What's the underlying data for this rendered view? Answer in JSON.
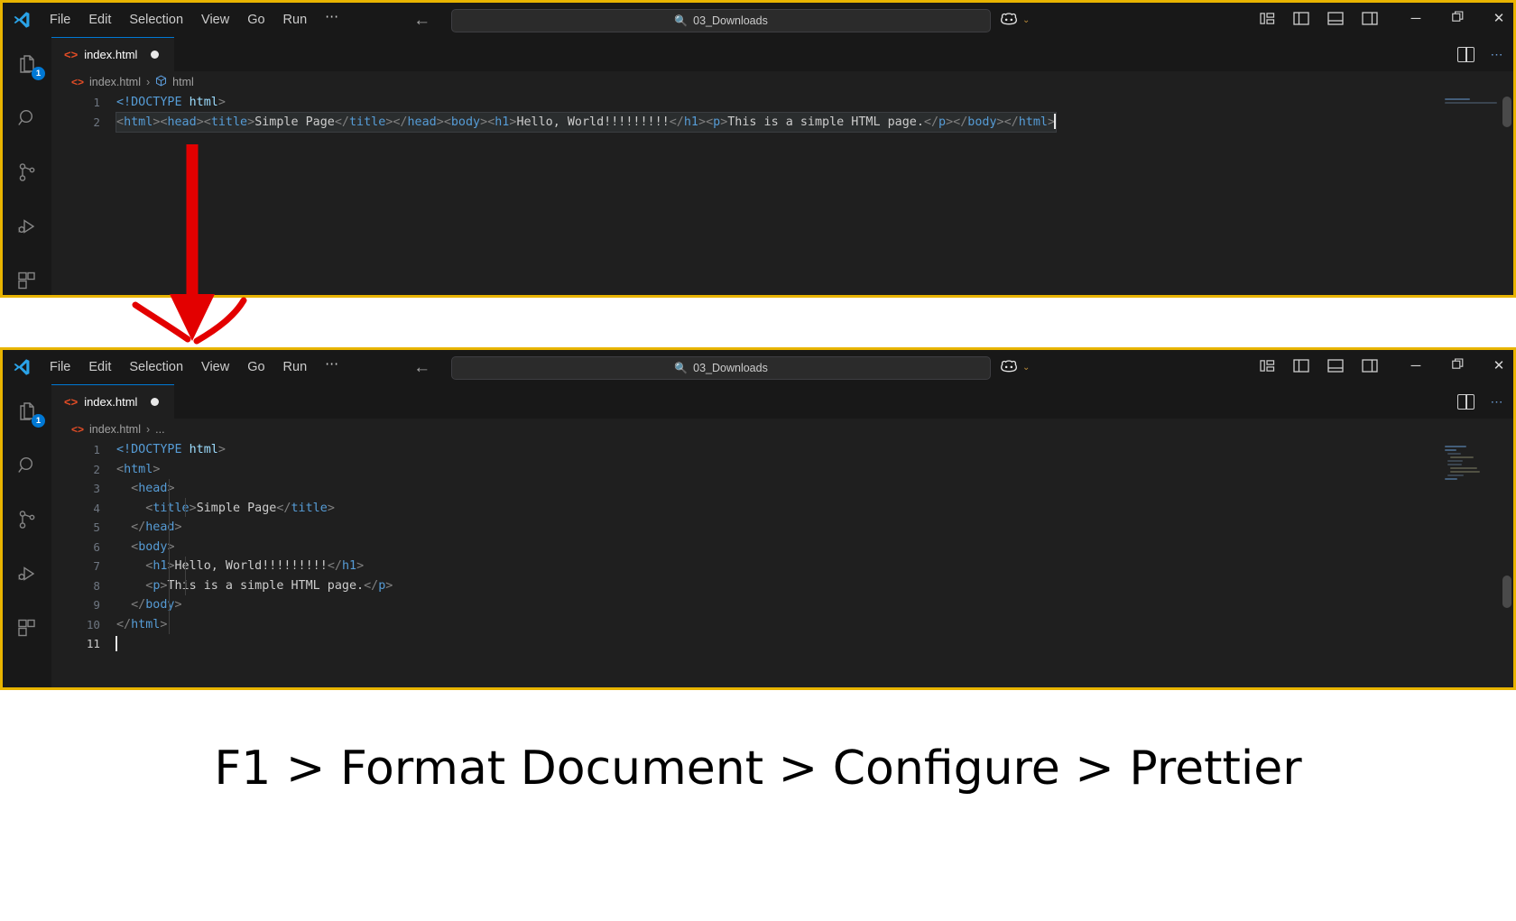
{
  "window": {
    "menu_items": [
      "File",
      "Edit",
      "Selection",
      "View",
      "Go",
      "Run",
      "⋯"
    ],
    "command_center_text": "03_Downloads",
    "search_icon": "search-icon",
    "copilot_icon": "copilot-icon",
    "chevron": "⌄",
    "nav_back": "←",
    "nav_forward": "→",
    "minimize": "─",
    "restore": "❐",
    "close": "✕"
  },
  "activitybar": {
    "items": [
      {
        "name": "explorer-icon",
        "badge": "1"
      },
      {
        "name": "search-icon",
        "badge": ""
      },
      {
        "name": "source-control-icon",
        "badge": ""
      },
      {
        "name": "run-and-debug-icon",
        "badge": ""
      },
      {
        "name": "extensions-icon",
        "badge": ""
      }
    ]
  },
  "editor_top": {
    "tab_label": "index.html",
    "tab_dirty": true,
    "breadcrumb": [
      "index.html",
      "html"
    ],
    "breadcrumb_separator": "›",
    "lines": [
      {
        "num": "1",
        "segments": [
          {
            "t": "<!DOCTYPE",
            "c": "tok-doctype"
          },
          {
            "t": " ",
            "c": "tok-text"
          },
          {
            "t": "html",
            "c": "tok-attrname"
          },
          {
            "t": ">",
            "c": "tok-bracket"
          }
        ]
      },
      {
        "num": "2",
        "selected": true,
        "segments": [
          {
            "t": "<",
            "c": "tok-bracket"
          },
          {
            "t": "html",
            "c": "tok-tag"
          },
          {
            "t": ">",
            "c": "tok-bracket"
          },
          {
            "t": "<",
            "c": "tok-bracket"
          },
          {
            "t": "head",
            "c": "tok-tag"
          },
          {
            "t": ">",
            "c": "tok-bracket"
          },
          {
            "t": "<",
            "c": "tok-bracket"
          },
          {
            "t": "title",
            "c": "tok-tag"
          },
          {
            "t": ">",
            "c": "tok-bracket"
          },
          {
            "t": "Simple Page",
            "c": "tok-text"
          },
          {
            "t": "</",
            "c": "tok-bracket"
          },
          {
            "t": "title",
            "c": "tok-tag"
          },
          {
            "t": ">",
            "c": "tok-bracket"
          },
          {
            "t": "</",
            "c": "tok-bracket"
          },
          {
            "t": "head",
            "c": "tok-tag"
          },
          {
            "t": ">",
            "c": "tok-bracket"
          },
          {
            "t": "<",
            "c": "tok-bracket"
          },
          {
            "t": "body",
            "c": "tok-tag"
          },
          {
            "t": ">",
            "c": "tok-bracket"
          },
          {
            "t": "<",
            "c": "tok-bracket"
          },
          {
            "t": "h1",
            "c": "tok-tag"
          },
          {
            "t": ">",
            "c": "tok-bracket"
          },
          {
            "t": "Hello, World!!!!!!!!!",
            "c": "tok-text"
          },
          {
            "t": "</",
            "c": "tok-bracket"
          },
          {
            "t": "h1",
            "c": "tok-tag"
          },
          {
            "t": ">",
            "c": "tok-bracket"
          },
          {
            "t": "<",
            "c": "tok-bracket"
          },
          {
            "t": "p",
            "c": "tok-tag"
          },
          {
            "t": ">",
            "c": "tok-bracket"
          },
          {
            "t": "This is a simple HTML page.",
            "c": "tok-text"
          },
          {
            "t": "</",
            "c": "tok-bracket"
          },
          {
            "t": "p",
            "c": "tok-tag"
          },
          {
            "t": ">",
            "c": "tok-bracket"
          },
          {
            "t": "</",
            "c": "tok-bracket"
          },
          {
            "t": "body",
            "c": "tok-tag"
          },
          {
            "t": ">",
            "c": "tok-bracket"
          },
          {
            "t": "</",
            "c": "tok-bracket"
          },
          {
            "t": "html",
            "c": "tok-tag"
          },
          {
            "t": ">",
            "c": "tok-bracket"
          }
        ]
      }
    ]
  },
  "editor_bottom": {
    "tab_label": "index.html",
    "tab_dirty": true,
    "breadcrumb": [
      "index.html",
      "..."
    ],
    "breadcrumb_separator": "›",
    "lines": [
      {
        "num": "1",
        "segments": [
          {
            "t": "<!DOCTYPE",
            "c": "tok-doctype"
          },
          {
            "t": " ",
            "c": "tok-text"
          },
          {
            "t": "html",
            "c": "tok-attrname"
          },
          {
            "t": ">",
            "c": "tok-bracket"
          }
        ]
      },
      {
        "num": "2",
        "segments": [
          {
            "t": "<",
            "c": "tok-bracket"
          },
          {
            "t": "html",
            "c": "tok-tag"
          },
          {
            "t": ">",
            "c": "tok-bracket"
          }
        ]
      },
      {
        "num": "3",
        "segments": [
          {
            "t": "  <",
            "c": "tok-bracket"
          },
          {
            "t": "head",
            "c": "tok-tag"
          },
          {
            "t": ">",
            "c": "tok-bracket"
          }
        ]
      },
      {
        "num": "4",
        "segments": [
          {
            "t": "    <",
            "c": "tok-bracket"
          },
          {
            "t": "title",
            "c": "tok-tag"
          },
          {
            "t": ">",
            "c": "tok-bracket"
          },
          {
            "t": "Simple Page",
            "c": "tok-text"
          },
          {
            "t": "</",
            "c": "tok-bracket"
          },
          {
            "t": "title",
            "c": "tok-tag"
          },
          {
            "t": ">",
            "c": "tok-bracket"
          }
        ]
      },
      {
        "num": "5",
        "segments": [
          {
            "t": "  </",
            "c": "tok-bracket"
          },
          {
            "t": "head",
            "c": "tok-tag"
          },
          {
            "t": ">",
            "c": "tok-bracket"
          }
        ]
      },
      {
        "num": "6",
        "segments": [
          {
            "t": "  <",
            "c": "tok-bracket"
          },
          {
            "t": "body",
            "c": "tok-tag"
          },
          {
            "t": ">",
            "c": "tok-bracket"
          }
        ]
      },
      {
        "num": "7",
        "segments": [
          {
            "t": "    <",
            "c": "tok-bracket"
          },
          {
            "t": "h1",
            "c": "tok-tag"
          },
          {
            "t": ">",
            "c": "tok-bracket"
          },
          {
            "t": "Hello, World!!!!!!!!!",
            "c": "tok-text"
          },
          {
            "t": "</",
            "c": "tok-bracket"
          },
          {
            "t": "h1",
            "c": "tok-tag"
          },
          {
            "t": ">",
            "c": "tok-bracket"
          }
        ]
      },
      {
        "num": "8",
        "segments": [
          {
            "t": "    <",
            "c": "tok-bracket"
          },
          {
            "t": "p",
            "c": "tok-tag"
          },
          {
            "t": ">",
            "c": "tok-bracket"
          },
          {
            "t": "This is a simple HTML page.",
            "c": "tok-text"
          },
          {
            "t": "</",
            "c": "tok-bracket"
          },
          {
            "t": "p",
            "c": "tok-tag"
          },
          {
            "t": ">",
            "c": "tok-bracket"
          }
        ]
      },
      {
        "num": "9",
        "segments": [
          {
            "t": "  </",
            "c": "tok-bracket"
          },
          {
            "t": "body",
            "c": "tok-tag"
          },
          {
            "t": ">",
            "c": "tok-bracket"
          }
        ]
      },
      {
        "num": "10",
        "segments": [
          {
            "t": "</",
            "c": "tok-bracket"
          },
          {
            "t": "html",
            "c": "tok-tag"
          },
          {
            "t": ">",
            "c": "tok-bracket"
          }
        ]
      },
      {
        "num": "11",
        "current": true,
        "cursor": true,
        "segments": []
      }
    ]
  },
  "caption": {
    "text": "F1 > Format Document > Configure > Prettier"
  },
  "colors": {
    "window_border": "#e8b400",
    "annotation_arrow": "#e30000",
    "tab_active_top": "#0078d4",
    "badge": "#0078d4",
    "html_icon": "#e44d26"
  }
}
